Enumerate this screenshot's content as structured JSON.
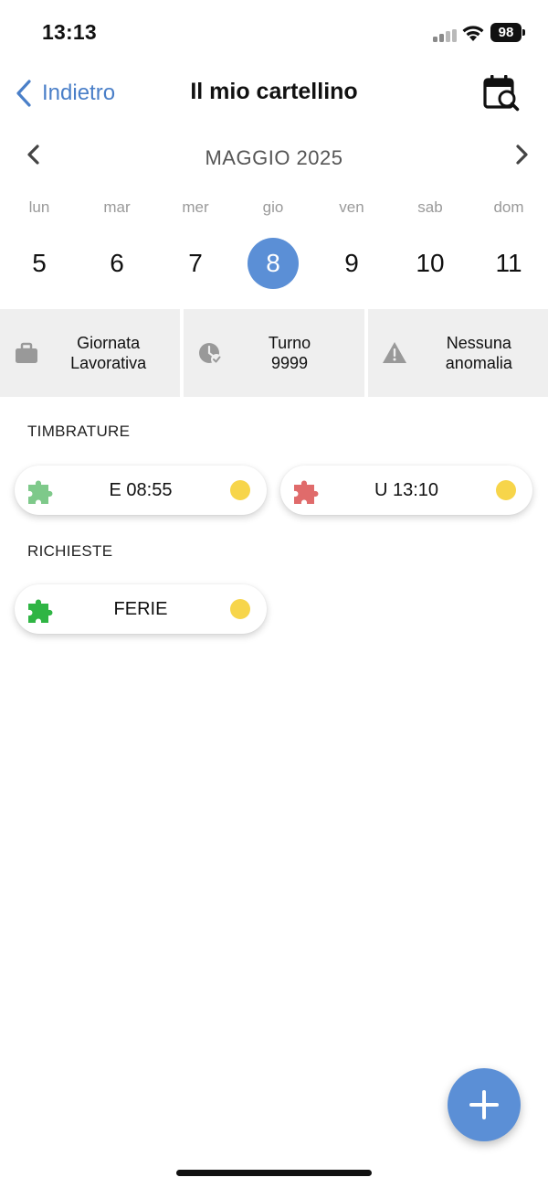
{
  "status_bar": {
    "time": "13:13",
    "battery": "98"
  },
  "nav": {
    "back_label": "Indietro",
    "title": "Il mio cartellino",
    "action_icon": "calendar-search-icon"
  },
  "calendar": {
    "month_label": "MAGGIO 2025",
    "days": [
      {
        "name": "lun",
        "num": "5"
      },
      {
        "name": "mar",
        "num": "6"
      },
      {
        "name": "mer",
        "num": "7"
      },
      {
        "name": "gio",
        "num": "8",
        "selected": true
      },
      {
        "name": "ven",
        "num": "9"
      },
      {
        "name": "sab",
        "num": "10"
      },
      {
        "name": "dom",
        "num": "11"
      }
    ]
  },
  "info": {
    "workday": {
      "line1": "Giornata",
      "line2": "Lavorativa",
      "icon": "briefcase-icon"
    },
    "shift": {
      "line1": "Turno",
      "line2": "9999",
      "icon": "clock-check-icon"
    },
    "anomaly": {
      "line1": "Nessuna",
      "line2": "anomalia",
      "icon": "warning-icon"
    }
  },
  "timbrature": {
    "label": "TIMBRATURE",
    "items": [
      {
        "text": "E 08:55",
        "puzzle_color": "#7ec98a",
        "status_color": "#f7d54a"
      },
      {
        "text": "U 13:10",
        "puzzle_color": "#e06b6b",
        "status_color": "#f7d54a"
      }
    ]
  },
  "richieste": {
    "label": "RICHIESTE",
    "items": [
      {
        "text": "FERIE",
        "puzzle_color": "#2fb544",
        "status_color": "#f7d54a"
      }
    ]
  },
  "colors": {
    "accent": "#5b8fd6",
    "link": "#4a7fc8",
    "status_pending": "#f7d54a"
  },
  "fab": {
    "icon": "plus-icon"
  }
}
